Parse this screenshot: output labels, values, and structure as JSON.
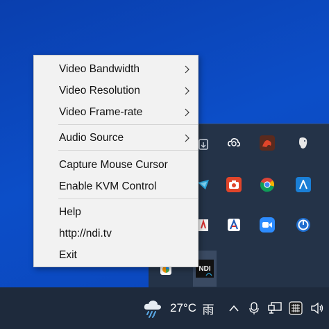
{
  "context_menu": {
    "items": [
      {
        "label": "Video Bandwidth",
        "submenu": true
      },
      {
        "label": "Video Resolution",
        "submenu": true
      },
      {
        "label": "Video Frame-rate",
        "submenu": true
      },
      {
        "label": "Audio Source",
        "submenu": true
      },
      {
        "label": "Capture Mouse Cursor",
        "submenu": false
      },
      {
        "label": "Enable KVM Control",
        "submenu": false
      },
      {
        "label": "Help",
        "submenu": false
      },
      {
        "label": "http://ndi.tv",
        "submenu": false
      },
      {
        "label": "Exit",
        "submenu": false
      }
    ]
  },
  "tray_flyout": {
    "icons": [
      {
        "name": "onedrive-icon"
      },
      {
        "name": "creative-cloud-icon"
      },
      {
        "name": "dragon-app-icon"
      },
      {
        "name": "evernote-icon"
      },
      {
        "name": "app-blue-icon"
      },
      {
        "name": "recorder-red-icon"
      },
      {
        "name": "chrome-icon"
      },
      {
        "name": "altium-icon"
      },
      {
        "name": "app-red-icon"
      },
      {
        "name": "acrobat-icon"
      },
      {
        "name": "zoom-icon"
      },
      {
        "name": "sync-icon"
      },
      {
        "name": "app-colorful-icon"
      },
      {
        "name": "ndi-icon"
      }
    ],
    "ndi_label": "NDI"
  },
  "taskbar": {
    "weather_temp": "27°C",
    "weather_condition": "雨"
  },
  "colors": {
    "desktop": "#0c4ec8",
    "taskbar": "#1e2a3c",
    "flyout": "#243348",
    "menu_bg": "#f2f2f2"
  }
}
